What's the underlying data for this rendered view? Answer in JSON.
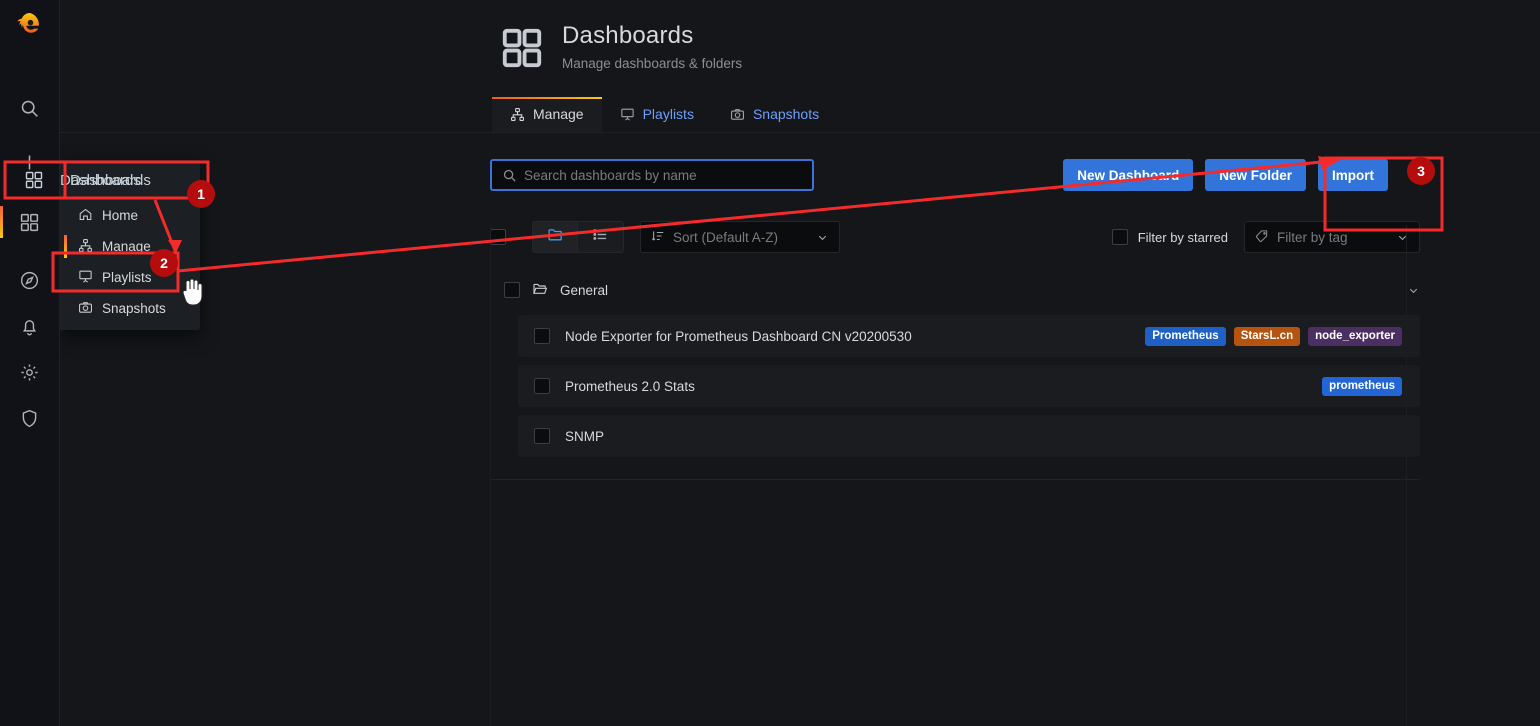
{
  "app": {
    "logo": "grafana-logo"
  },
  "rail": {
    "items": [
      {
        "icon": "search-icon",
        "name": "search"
      },
      {
        "icon": "plus-icon",
        "name": "create"
      },
      {
        "icon": "dashboards-icon",
        "name": "dashboards",
        "active": true
      },
      {
        "icon": "compass-icon",
        "name": "explore"
      },
      {
        "icon": "bell-icon",
        "name": "alerting"
      },
      {
        "icon": "gear-icon",
        "name": "configuration"
      },
      {
        "icon": "shield-icon",
        "name": "server-admin"
      }
    ]
  },
  "flyout": {
    "header": "Dashboards",
    "items": [
      {
        "label": "Home",
        "icon": "home-icon",
        "active": false
      },
      {
        "label": "Manage",
        "icon": "sitemap-icon",
        "active": true
      },
      {
        "label": "Playlists",
        "icon": "presentation-icon",
        "active": false
      },
      {
        "label": "Snapshots",
        "icon": "camera-icon",
        "active": false
      }
    ]
  },
  "header": {
    "icon": "apps-grid-icon",
    "title": "Dashboards",
    "subtitle": "Manage dashboards & folders"
  },
  "tabs": [
    {
      "label": "Manage",
      "icon": "sitemap-icon",
      "active": true
    },
    {
      "label": "Playlists",
      "icon": "presentation-icon",
      "active": false
    },
    {
      "label": "Snapshots",
      "icon": "camera-icon",
      "active": false
    }
  ],
  "search": {
    "placeholder": "Search dashboards by name",
    "value": "",
    "icon": "search-icon"
  },
  "actions": {
    "new_dashboard": "New Dashboard",
    "new_folder": "New Folder",
    "import": "Import"
  },
  "toolbar": {
    "select_all": "",
    "folder_view_icon": "folder-icon",
    "list_view_icon": "list-icon",
    "sort": {
      "label": "Sort (Default A-Z)",
      "icon": "sort-amount-down-icon"
    },
    "filter_starred": "Filter by starred",
    "filter_tag": {
      "placeholder": "Filter by tag",
      "icon": "tag-icon"
    }
  },
  "list": {
    "folder": {
      "name": "General",
      "icon": "folder-open-icon"
    },
    "dashboards": [
      {
        "title": "Node Exporter for Prometheus Dashboard CN v20200530",
        "tags": [
          {
            "label": "Prometheus",
            "color": "#1f60c4"
          },
          {
            "label": "StarsL.cn",
            "color": "#b5530f"
          },
          {
            "label": "node_exporter",
            "color": "#4b2f62"
          }
        ]
      },
      {
        "title": "Prometheus 2.0 Stats",
        "tags": [
          {
            "label": "prometheus",
            "color": "#2265d4"
          }
        ]
      },
      {
        "title": "SNMP",
        "tags": []
      }
    ]
  },
  "annotations": {
    "badges": [
      {
        "id": "1",
        "text": "1"
      },
      {
        "id": "2",
        "text": "2"
      },
      {
        "id": "3",
        "text": "3"
      }
    ],
    "highlight_color": "#f52b2b"
  },
  "colors": {
    "accent_blue": "#3274d9",
    "brand_gradient_start": "#f05a28",
    "brand_gradient_end": "#fbca0a",
    "page_bg": "#141619",
    "panel_bg": "#1a1c1f"
  }
}
